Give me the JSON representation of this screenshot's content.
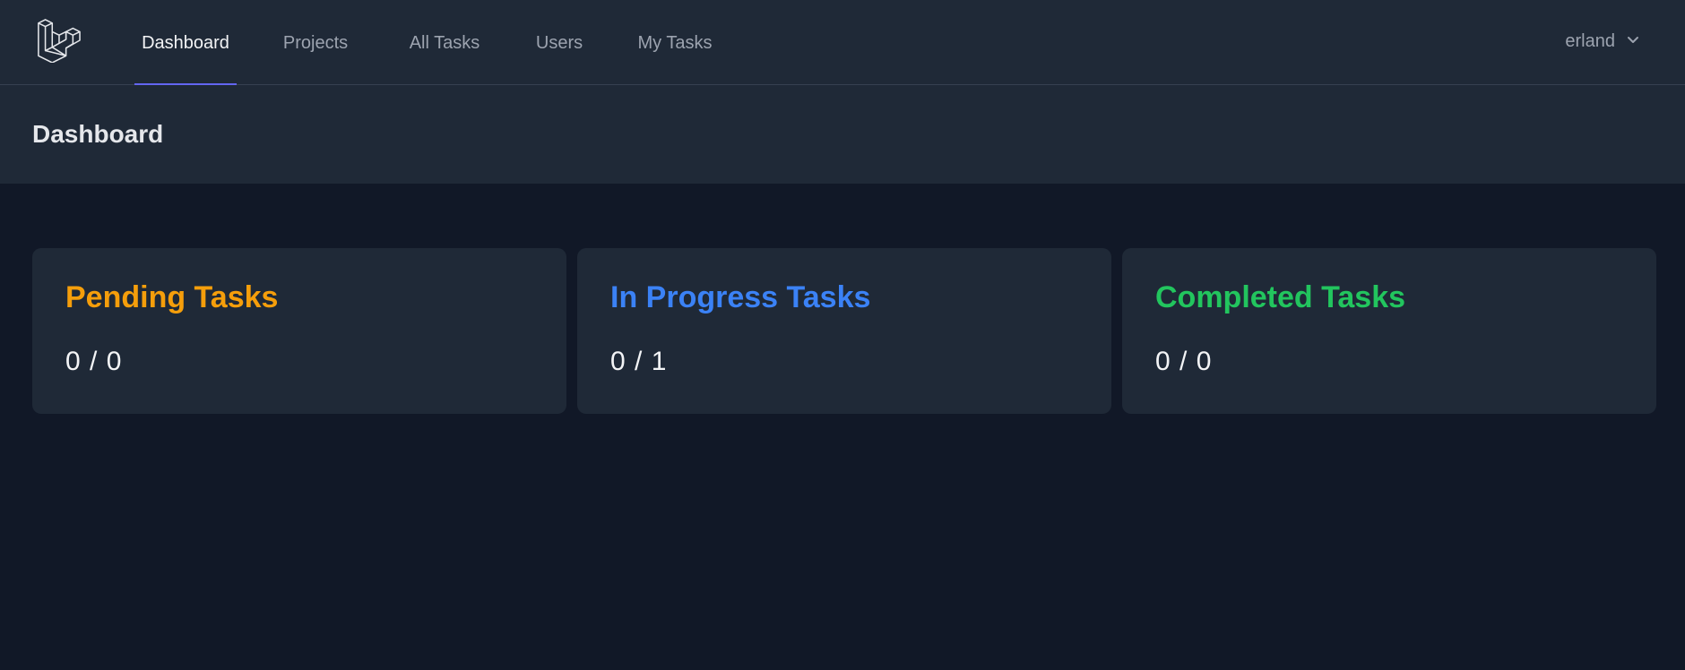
{
  "nav": {
    "links": [
      {
        "label": "Dashboard",
        "active": true
      },
      {
        "label": "Projects",
        "active": false
      },
      {
        "label": "All Tasks",
        "active": false
      },
      {
        "label": "Users",
        "active": false
      },
      {
        "label": "My Tasks",
        "active": false
      }
    ],
    "user_name": "erland",
    "logo_icon": "laravel-logo-icon",
    "dropdown_icon": "chevron-down-icon",
    "active_underline_color": "#6366f1"
  },
  "header": {
    "title": "Dashboard"
  },
  "cards": [
    {
      "title": "Pending Tasks",
      "value": "0 / 0",
      "color": "#f59e0b"
    },
    {
      "title": "In Progress Tasks",
      "value": "0 / 1",
      "color": "#3b82f6"
    },
    {
      "title": "Completed Tasks",
      "value": "0 / 0",
      "color": "#22c55e"
    }
  ]
}
